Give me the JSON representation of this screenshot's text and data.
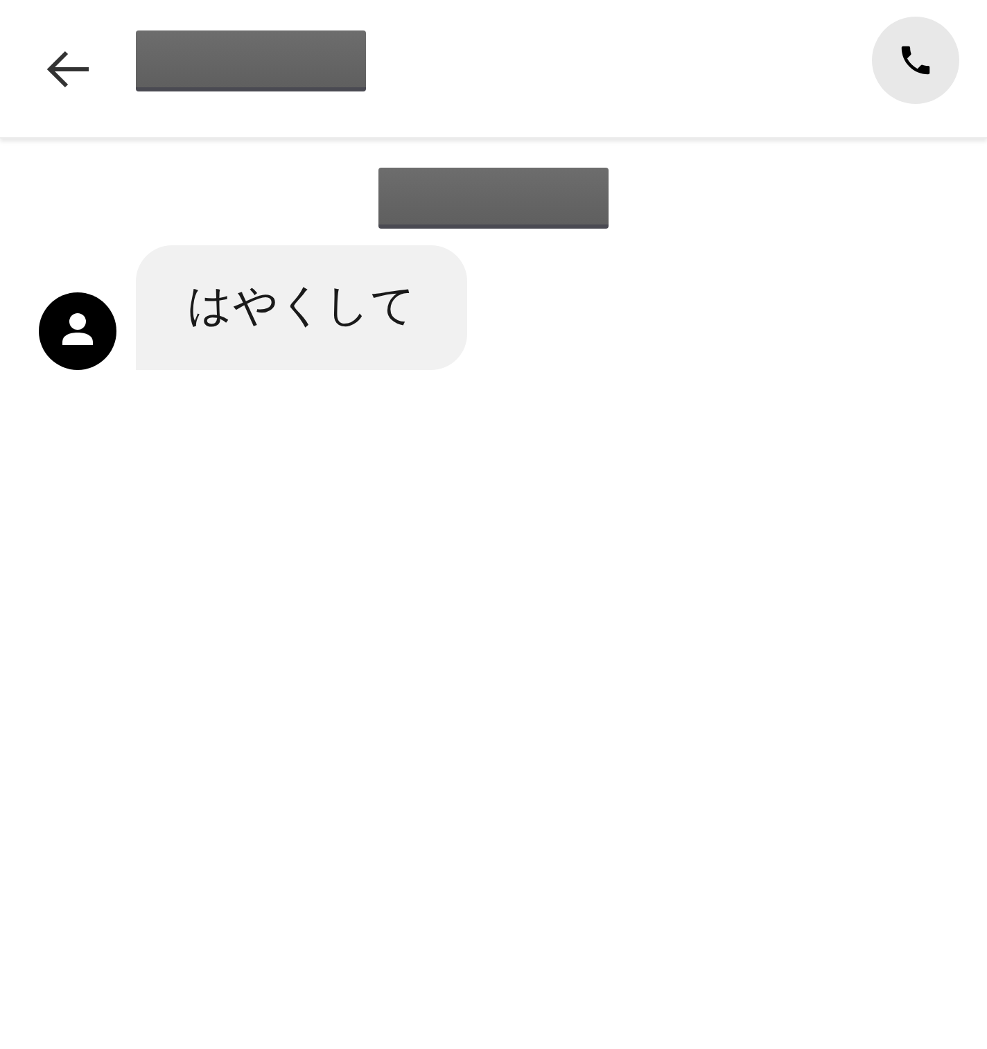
{
  "messages": [
    {
      "kind": "incoming",
      "text": "はやくして"
    }
  ]
}
